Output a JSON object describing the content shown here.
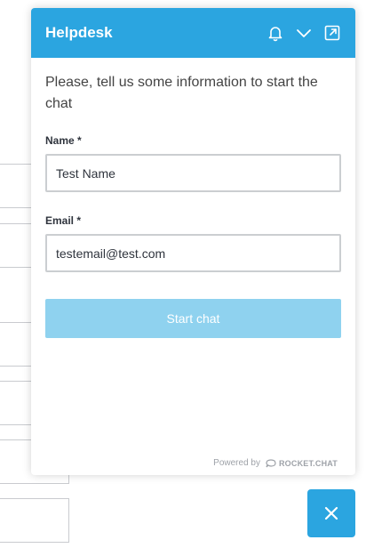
{
  "header": {
    "title": "Helpdesk",
    "icons": [
      "bell-icon",
      "chevron-down-icon",
      "popout-icon"
    ]
  },
  "form": {
    "intro": "Please, tell us some information to start the chat",
    "name_label": "Name *",
    "name_value": "Test Name",
    "email_label": "Email *",
    "email_value": "testemail@test.com",
    "submit_label": "Start chat"
  },
  "footer": {
    "powered_by": "Powered by",
    "brand": "ROCKET.CHAT"
  },
  "colors": {
    "accent": "#2ba5e0",
    "button_disabled": "#8fd2ef",
    "text": "#444444"
  },
  "close_button": {
    "icon": "close-icon"
  }
}
